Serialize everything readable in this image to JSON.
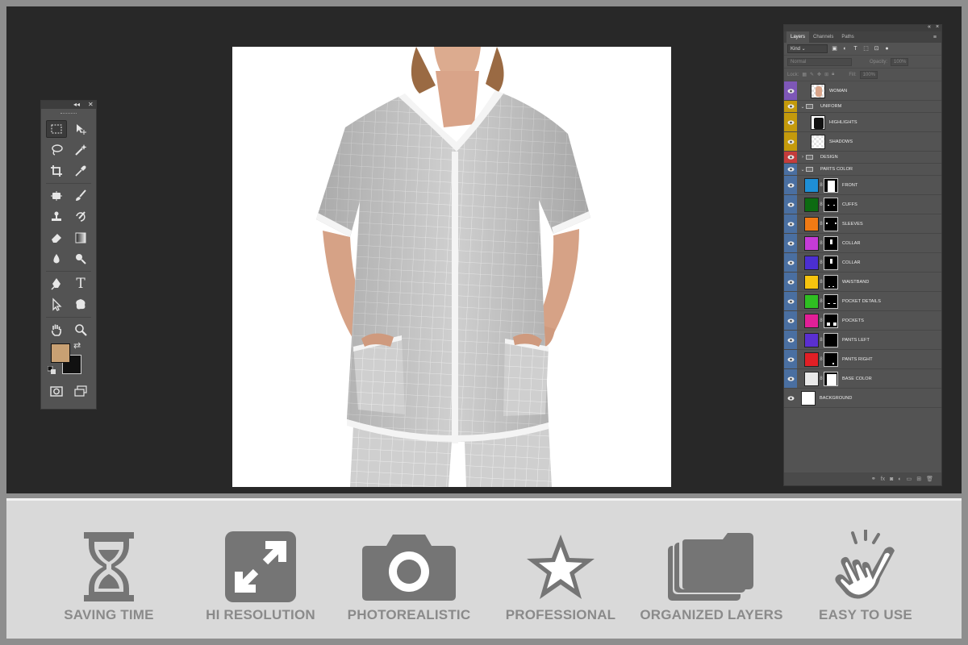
{
  "layers_panel": {
    "tabs": [
      "Layers",
      "Channels",
      "Paths"
    ],
    "kind_filter": "Kind",
    "blend_mode": "Normal",
    "opacity_label": "Opacity:",
    "opacity_value": "100%",
    "lock_label": "Lock:",
    "fill_label": "Fill:",
    "fill_value": "100%",
    "layers": [
      {
        "name": "WOMAN",
        "color": "#7e57b7",
        "kind": "pixel",
        "thumb": "woman"
      },
      {
        "name": "UNIFORM",
        "color": "#c49a0c",
        "kind": "group",
        "open": true
      },
      {
        "name": "HIGHLIGHTS",
        "color": "#c49a0c",
        "kind": "pixel",
        "thumb": "highlight"
      },
      {
        "name": "SHADOWS",
        "color": "#c49a0c",
        "kind": "pixel",
        "thumb": "shadow"
      },
      {
        "name": "DESIGN",
        "color": "#c43c3c",
        "kind": "group",
        "open": false
      },
      {
        "name": "PARTS COLOR",
        "color": "#4a6fa1",
        "kind": "group",
        "open": true
      },
      {
        "name": "FRONT",
        "color": "#4a6fa1",
        "kind": "fill",
        "fill": "#1e8fd6"
      },
      {
        "name": "CUFFS",
        "color": "#4a6fa1",
        "kind": "fill",
        "fill": "#0d6b12"
      },
      {
        "name": "SLEEVES",
        "color": "#4a6fa1",
        "kind": "fill",
        "fill": "#f07a14"
      },
      {
        "name": "COLLAR",
        "color": "#4a6fa1",
        "kind": "fill",
        "fill": "#c53bd7"
      },
      {
        "name": "COLLAR",
        "color": "#4a6fa1",
        "kind": "fill",
        "fill": "#4b2fd1"
      },
      {
        "name": "WAISTBAND",
        "color": "#4a6fa1",
        "kind": "fill",
        "fill": "#f7c40e"
      },
      {
        "name": "POCKET DETAILS",
        "color": "#4a6fa1",
        "kind": "fill",
        "fill": "#2fbf22"
      },
      {
        "name": "POCKETS",
        "color": "#4a6fa1",
        "kind": "fill",
        "fill": "#e21f97"
      },
      {
        "name": "PANTS LEFT",
        "color": "#4a6fa1",
        "kind": "fill",
        "fill": "#5a2fd1"
      },
      {
        "name": "PANTS RIGHT",
        "color": "#4a6fa1",
        "kind": "fill",
        "fill": "#e21f25"
      },
      {
        "name": "BASE COLOR",
        "color": "#4a6fa1",
        "kind": "fill",
        "fill": "#e9e9e9"
      },
      {
        "name": "BACKGROUND",
        "color": "#535353",
        "kind": "white"
      }
    ]
  },
  "features": [
    {
      "label": "SAVING TIME",
      "icon": "hourglass-icon"
    },
    {
      "label": "HI RESOLUTION",
      "icon": "expand-icon"
    },
    {
      "label": "PHOTOREALISTIC",
      "icon": "camera-icon"
    },
    {
      "label": "PROFESSIONAL",
      "icon": "star-icon"
    },
    {
      "label": "ORGANIZED LAYERS",
      "icon": "folders-icon"
    },
    {
      "label": "EASY TO USE",
      "icon": "hand-tap-icon"
    }
  ],
  "colors": {
    "foreground_swatch": "#c8a073",
    "background_swatch": "#111111",
    "workspace": "#282828",
    "icon_gray": "#757575"
  }
}
